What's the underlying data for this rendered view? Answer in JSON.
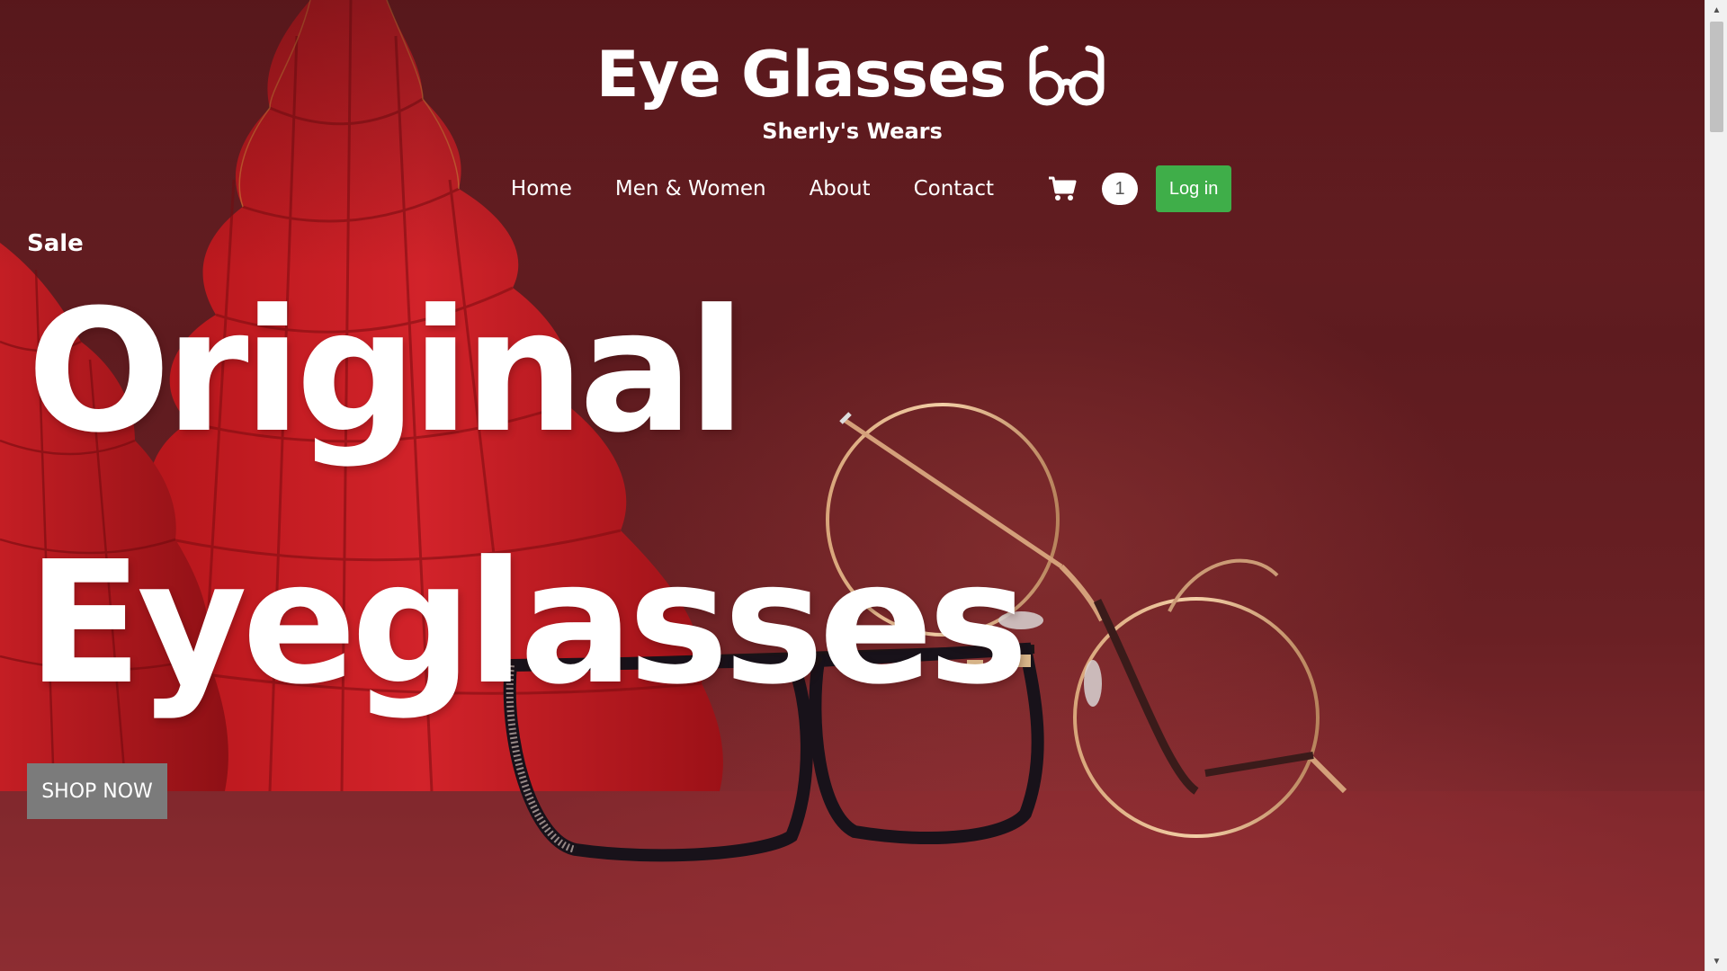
{
  "brand": {
    "title": "Eye Glasses",
    "logo_icon": "eyeglasses-icon",
    "subtitle": "Sherly's Wears"
  },
  "nav": {
    "items": [
      {
        "label": "Home"
      },
      {
        "label": "Men & Women"
      },
      {
        "label": "About"
      },
      {
        "label": "Contact"
      }
    ],
    "cart_icon": "shopping-cart-icon",
    "cart_count": "1",
    "login_label": "Log in"
  },
  "hero": {
    "tag": "Sale",
    "headline_line1": "Original",
    "headline_line2": "Eyeglasses",
    "cta_label": "SHOP NOW"
  },
  "colors": {
    "background": "#6a2024",
    "login_button": "#3fae49",
    "cta_button": "#7b7b7b",
    "text": "#ffffff"
  }
}
